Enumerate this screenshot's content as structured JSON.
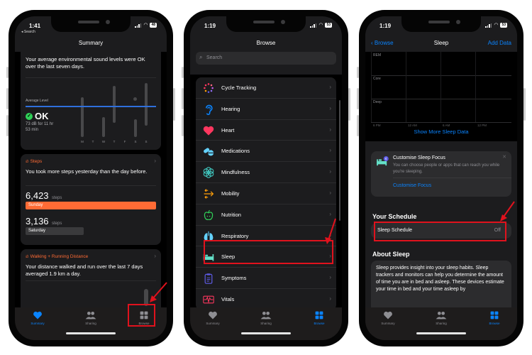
{
  "phones": [
    {
      "status": {
        "time": "1:41",
        "back_app": "◂ Search",
        "battery": "48"
      },
      "nav": {
        "title": "Summary"
      },
      "sound_card": {
        "text": "Your average environmental sound levels were OK over the last seven days.",
        "avg_label": "Average Level",
        "status": "OK",
        "detail_line1": "73 dB for 11 hr",
        "detail_line2": "53 min",
        "days": [
          "M",
          "T",
          "W",
          "T",
          "F",
          "S",
          "S"
        ]
      },
      "steps_card": {
        "title": "Steps",
        "text": "You took more steps yesterday than the day before.",
        "today_value": "6,423",
        "today_unit": "steps",
        "today_label": "Sunday",
        "prev_value": "3,136",
        "prev_unit": "steps",
        "prev_label": "Saturday"
      },
      "distance_card": {
        "title": "Walking + Running Distance",
        "text": "Your distance walked and run over the last 7 days averaged 1.9 km a day."
      },
      "tabs": [
        {
          "label": "Summary",
          "icon": "heart-icon",
          "active": true
        },
        {
          "label": "Sharing",
          "icon": "people-icon",
          "active": false
        },
        {
          "label": "Browse",
          "icon": "grid-icon",
          "active": false
        }
      ]
    },
    {
      "status": {
        "time": "1:19",
        "battery": "53"
      },
      "nav": {
        "title": "Browse"
      },
      "search": {
        "placeholder": "Search"
      },
      "categories": [
        {
          "label": "Cycle Tracking",
          "icon": "cycle-tracking-icon"
        },
        {
          "label": "Hearing",
          "icon": "ear-icon"
        },
        {
          "label": "Heart",
          "icon": "heart-icon"
        },
        {
          "label": "Medications",
          "icon": "pills-icon"
        },
        {
          "label": "Mindfulness",
          "icon": "flower-icon"
        },
        {
          "label": "Mobility",
          "icon": "arrows-icon"
        },
        {
          "label": "Nutrition",
          "icon": "apple-icon"
        },
        {
          "label": "Respiratory",
          "icon": "lungs-icon"
        },
        {
          "label": "Sleep",
          "icon": "bed-icon"
        },
        {
          "label": "Symptoms",
          "icon": "clipboard-icon"
        },
        {
          "label": "Vitals",
          "icon": "waveform-icon"
        }
      ],
      "tabs": [
        {
          "label": "Summary",
          "icon": "heart-icon",
          "active": false
        },
        {
          "label": "Sharing",
          "icon": "people-icon",
          "active": false
        },
        {
          "label": "Browse",
          "icon": "grid-icon",
          "active": true
        }
      ]
    },
    {
      "status": {
        "time": "1:19",
        "battery": "53"
      },
      "nav": {
        "back": "Browse",
        "title": "Sleep",
        "action": "Add Data"
      },
      "sleep_chart": {
        "stages": [
          "REM",
          "Core",
          "Deep"
        ],
        "times": [
          "6 PM",
          "12 AM",
          "6 AM",
          "12 PM"
        ]
      },
      "show_more": "Show More Sleep Data",
      "focus_card": {
        "title": "Customise Sleep Focus",
        "text": "You can choose people or apps that can reach you while you're sleeping.",
        "action": "Customise Focus"
      },
      "schedule": {
        "heading": "Your Schedule",
        "row_label": "Sleep Schedule",
        "row_value": "Off"
      },
      "about": {
        "heading": "About Sleep",
        "text": "Sleep provides insight into your sleep habits. Sleep trackers and monitors can help you determine the amount of time you are in bed and asleep. These devices estimate your time in bed and your time asleep by"
      },
      "tabs": [
        {
          "label": "Summary",
          "icon": "heart-icon",
          "active": false
        },
        {
          "label": "Sharing",
          "icon": "people-icon",
          "active": false
        },
        {
          "label": "Browse",
          "icon": "grid-icon",
          "active": true
        }
      ]
    }
  ],
  "colors": {
    "accent_blue": "#0a84ff",
    "steps_orange": "#ff6b35",
    "highlight_red": "#e0121d",
    "ok_green": "#30d158"
  }
}
